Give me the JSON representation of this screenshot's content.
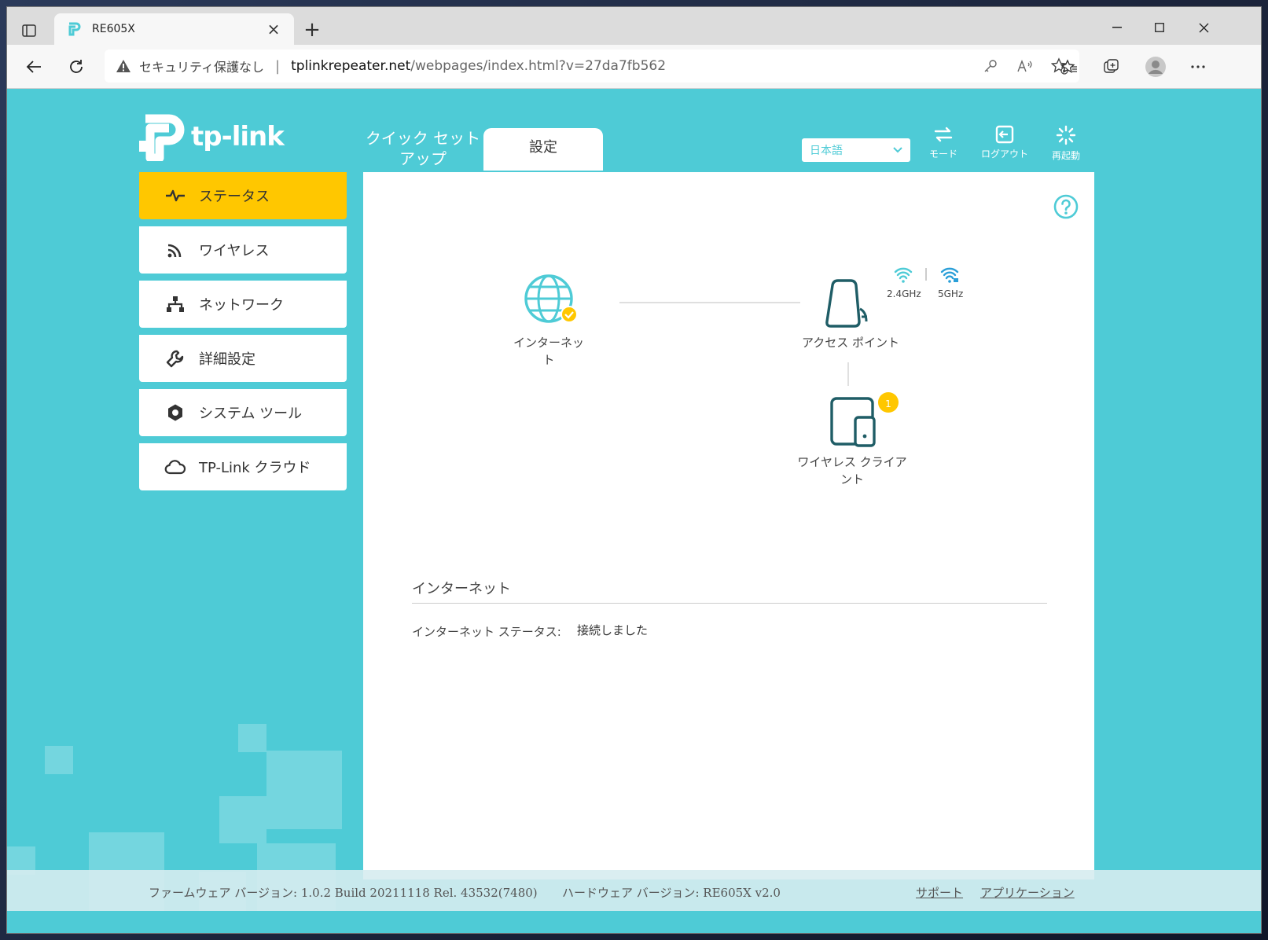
{
  "browser": {
    "tab_title": "RE605X",
    "tab_close": "×",
    "new_tab": "+",
    "security_label": "セキュリティ保護なし",
    "address_separator": "|",
    "url_host": "tplinkrepeater.net",
    "url_path": "/webpages/index.html?v=27da7fb562"
  },
  "header": {
    "logo_text": "tp-link",
    "tabs": [
      {
        "label": "クイック セット\nアップ"
      },
      {
        "label": "設定"
      }
    ],
    "language": "日本語",
    "mode_label": "モード",
    "logout_label": "ログアウト",
    "reboot_label": "再起動"
  },
  "sidebar": {
    "items": [
      {
        "label": "ステータス",
        "icon": "pulse-icon"
      },
      {
        "label": "ワイヤレス",
        "icon": "wireless-icon"
      },
      {
        "label": "ネットワーク",
        "icon": "network-icon"
      },
      {
        "label": "詳細設定",
        "icon": "wrench-icon"
      },
      {
        "label": "システム ツール",
        "icon": "gear-icon"
      },
      {
        "label": "TP-Link クラウド",
        "icon": "cloud-icon"
      }
    ]
  },
  "topology": {
    "internet_label": "インターネッ\nト",
    "access_point_label": "アクセス ポイント",
    "band_24": "2.4GHz",
    "band_5": "5GHz",
    "client_label": "ワイヤレス クライア\nント",
    "client_count": "1"
  },
  "internet_section": {
    "title": "インターネット",
    "status_label": "インターネット ステータス:",
    "status_value": "接続しました"
  },
  "footer": {
    "firmware": "ファームウェア バージョン: 1.0.2 Build 20211118 Rel. 43532(7480)",
    "hardware": "ハードウェア バージョン: RE605X v2.0",
    "support_link": "サポート",
    "app_link": "アプリケーション"
  },
  "colors": {
    "accent": "#4ecbd6",
    "active_menu": "#ffc700",
    "icon_dark": "#1f5d66",
    "badge": "#ffc700"
  }
}
